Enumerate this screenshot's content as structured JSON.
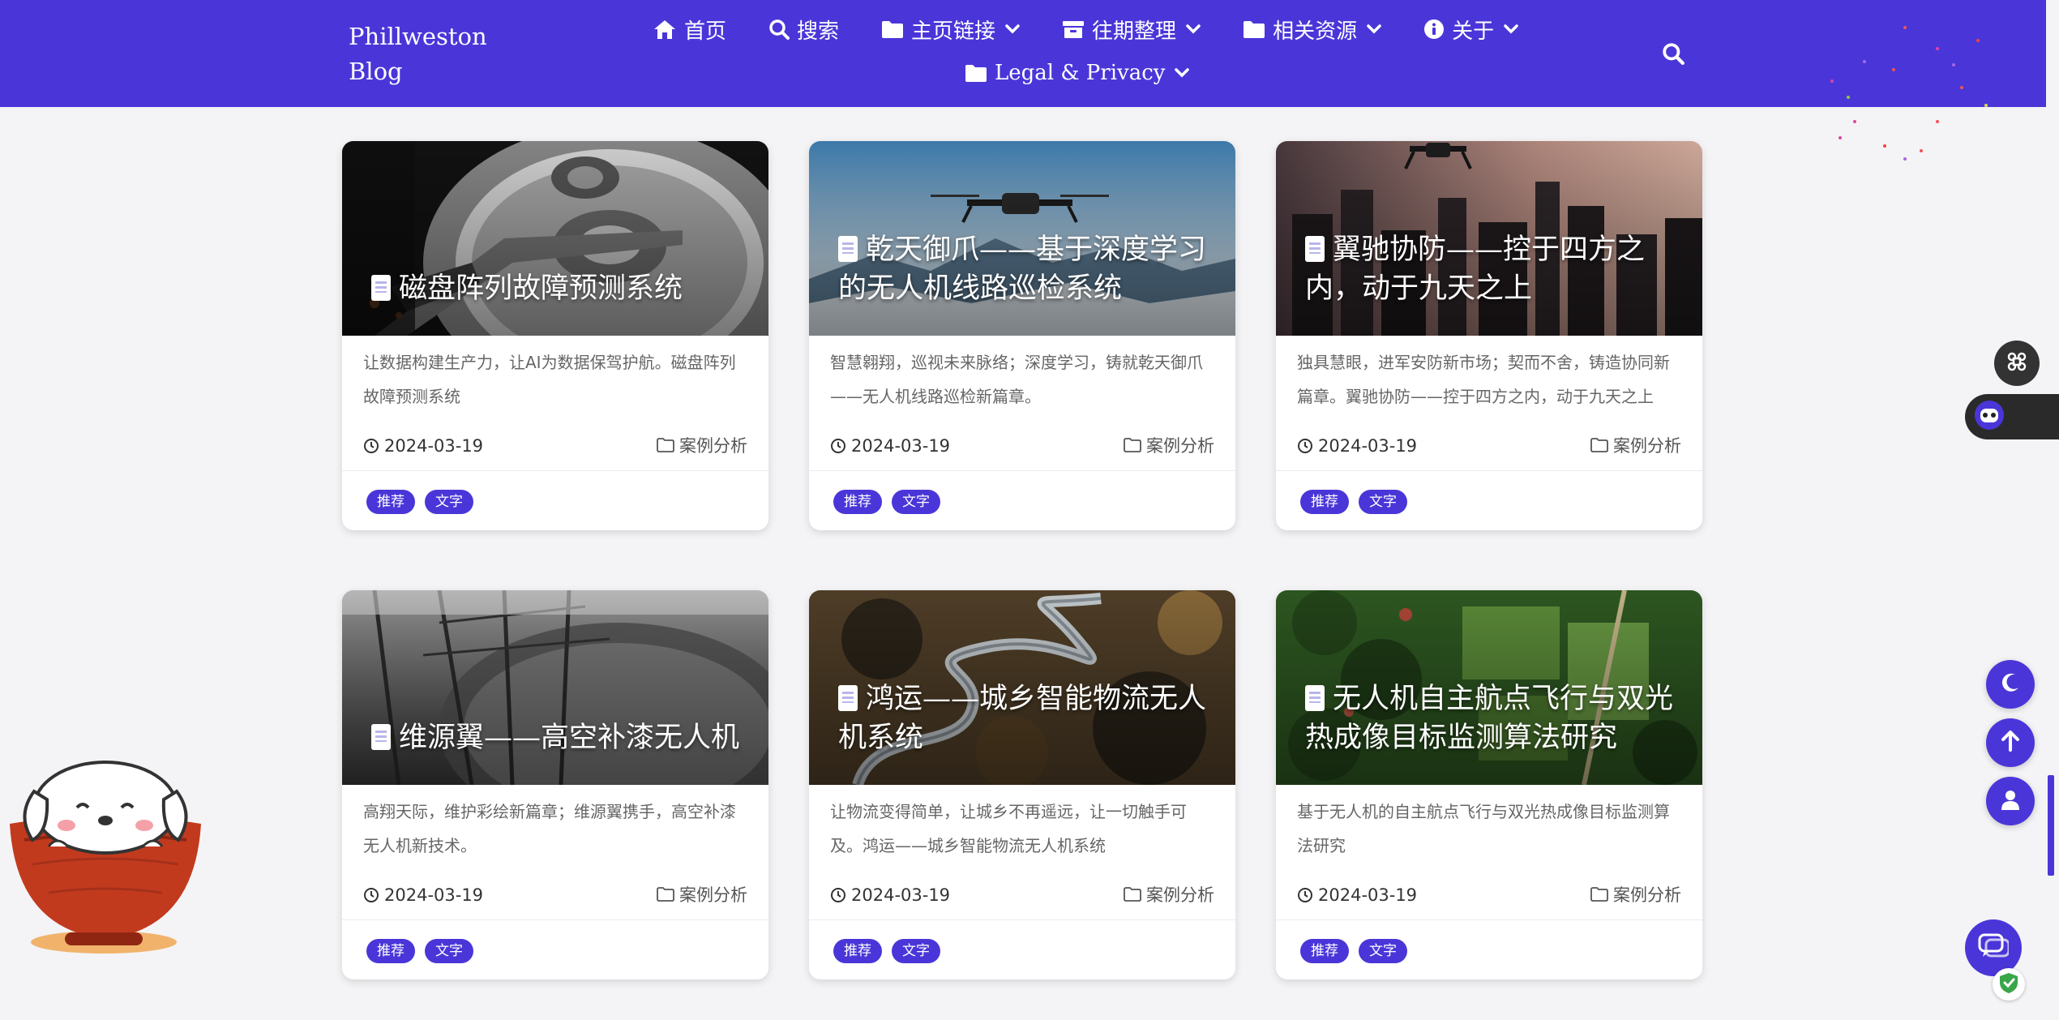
{
  "nav": {
    "brand": "Phillweston Blog",
    "items_row1": [
      {
        "label": "首页",
        "icon": "home-icon",
        "dropdown": false
      },
      {
        "label": "搜索",
        "icon": "search-icon",
        "dropdown": false
      },
      {
        "label": "主页链接",
        "icon": "folder-icon",
        "dropdown": true
      },
      {
        "label": "往期整理",
        "icon": "archive-icon",
        "dropdown": true
      },
      {
        "label": "相关资源",
        "icon": "folder-icon",
        "dropdown": true
      },
      {
        "label": "关于",
        "icon": "info-icon",
        "dropdown": true
      }
    ],
    "items_row2": [
      {
        "label": "Legal & Privacy",
        "icon": "folder-icon",
        "dropdown": true
      }
    ]
  },
  "posts": [
    {
      "title": "磁盘阵列故障预测系统",
      "excerpt": "让数据构建生产力，让AI为数据保驾护航。磁盘阵列故障预测系统",
      "date": "2024-03-19",
      "category": "案例分析",
      "tags": [
        "推荐",
        "文字"
      ],
      "image": "hard-drive-photo"
    },
    {
      "title": "乾天御爪——基于深度学习的无人机线路巡检系统",
      "excerpt": "智慧翱翔，巡视未来脉络；深度学习，铸就乾天御爪——无人机线路巡检新篇章。",
      "date": "2024-03-19",
      "category": "案例分析",
      "tags": [
        "推荐",
        "文字"
      ],
      "image": "drone-sky-photo"
    },
    {
      "title": "翼驰协防——控于四方之内，动于九天之上",
      "excerpt": "独具慧眼，进军安防新市场；契而不舍，铸造协同新篇章。翼驰协防——控于四方之内，动于九天之上",
      "date": "2024-03-19",
      "category": "案例分析",
      "tags": [
        "推荐",
        "文字"
      ],
      "image": "drone-city-photo"
    },
    {
      "title": "维源翼——高空补漆无人机",
      "excerpt": "高翔天际，维护彩绘新篇章；维源翼携手，高空补漆无人机新技术。",
      "date": "2024-03-19",
      "category": "案例分析",
      "tags": [
        "推荐",
        "文字"
      ],
      "image": "industrial-tank-photo"
    },
    {
      "title": "鸿运——城乡智能物流无人机系统",
      "excerpt": "让物流变得简单，让城乡不再遥远，让一切触手可及。鸿运——城乡智能物流无人机系统",
      "date": "2024-03-19",
      "category": "案例分析",
      "tags": [
        "推荐",
        "文字"
      ],
      "image": "winding-road-photo"
    },
    {
      "title": "无人机自主航点飞行与双光热成像目标监测算法研究",
      "excerpt": "基于无人机的自主航点飞行与双光热成像目标监测算法研究",
      "date": "2024-03-19",
      "category": "案例分析",
      "tags": [
        "推荐",
        "文字"
      ],
      "image": "green-fields-photo"
    }
  ],
  "colors": {
    "accent": "#4a36d8",
    "background": "#f4f4f6",
    "card": "#ffffff"
  }
}
